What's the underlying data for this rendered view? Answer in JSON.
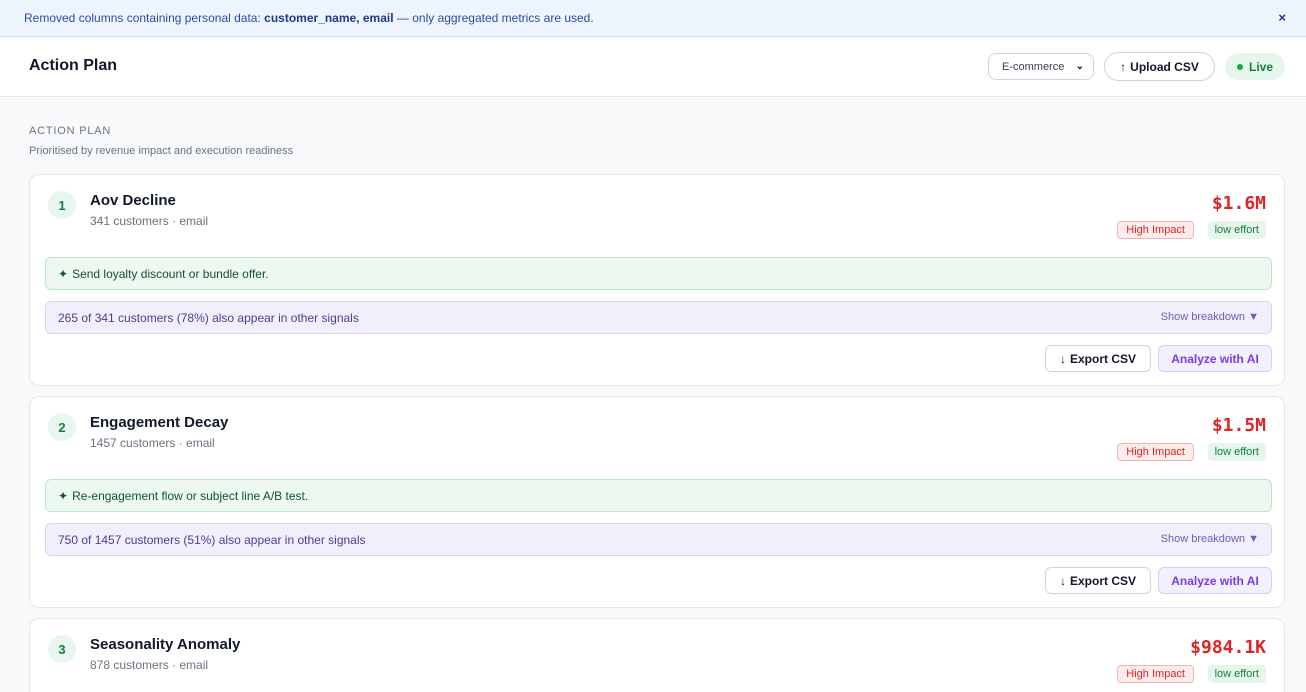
{
  "banner": {
    "prefix": "Removed columns containing personal data:",
    "columns": "customer_name, email",
    "suffix": "— only aggregated metrics are used.",
    "close": "×"
  },
  "header": {
    "title": "Action Plan",
    "vertical_select": "E-commerce",
    "upload_label": "Upload CSV",
    "status": "Live"
  },
  "section": {
    "label": "ACTION PLAN",
    "subtitle": "Prioritised by revenue impact and execution readiness"
  },
  "cards": [
    {
      "rank": "1",
      "name": "Aov Decline",
      "meta": "341 customers · email",
      "amount": "$1.6M",
      "impact": "High Impact",
      "effort": "low effort",
      "action": "Send loyalty discount or bundle offer.",
      "overlap": "265 of 341 customers (78%) also appear in other signals",
      "toggle": "Show breakdown",
      "export": "Export CSV",
      "analyze": "Analyze with AI"
    },
    {
      "rank": "2",
      "name": "Engagement Decay",
      "meta": "1457 customers · email",
      "amount": "$1.5M",
      "impact": "High Impact",
      "effort": "low effort",
      "action": "Re-engagement flow or subject line A/B test.",
      "overlap": "750 of 1457 customers (51%) also appear in other signals",
      "toggle": "Show breakdown",
      "export": "Export CSV",
      "analyze": "Analyze with AI"
    },
    {
      "rank": "3",
      "name": "Seasonality Anomaly",
      "meta": "878 customers · email",
      "amount": "$984.1K",
      "impact": "High Impact",
      "effort": "low effort"
    }
  ]
}
